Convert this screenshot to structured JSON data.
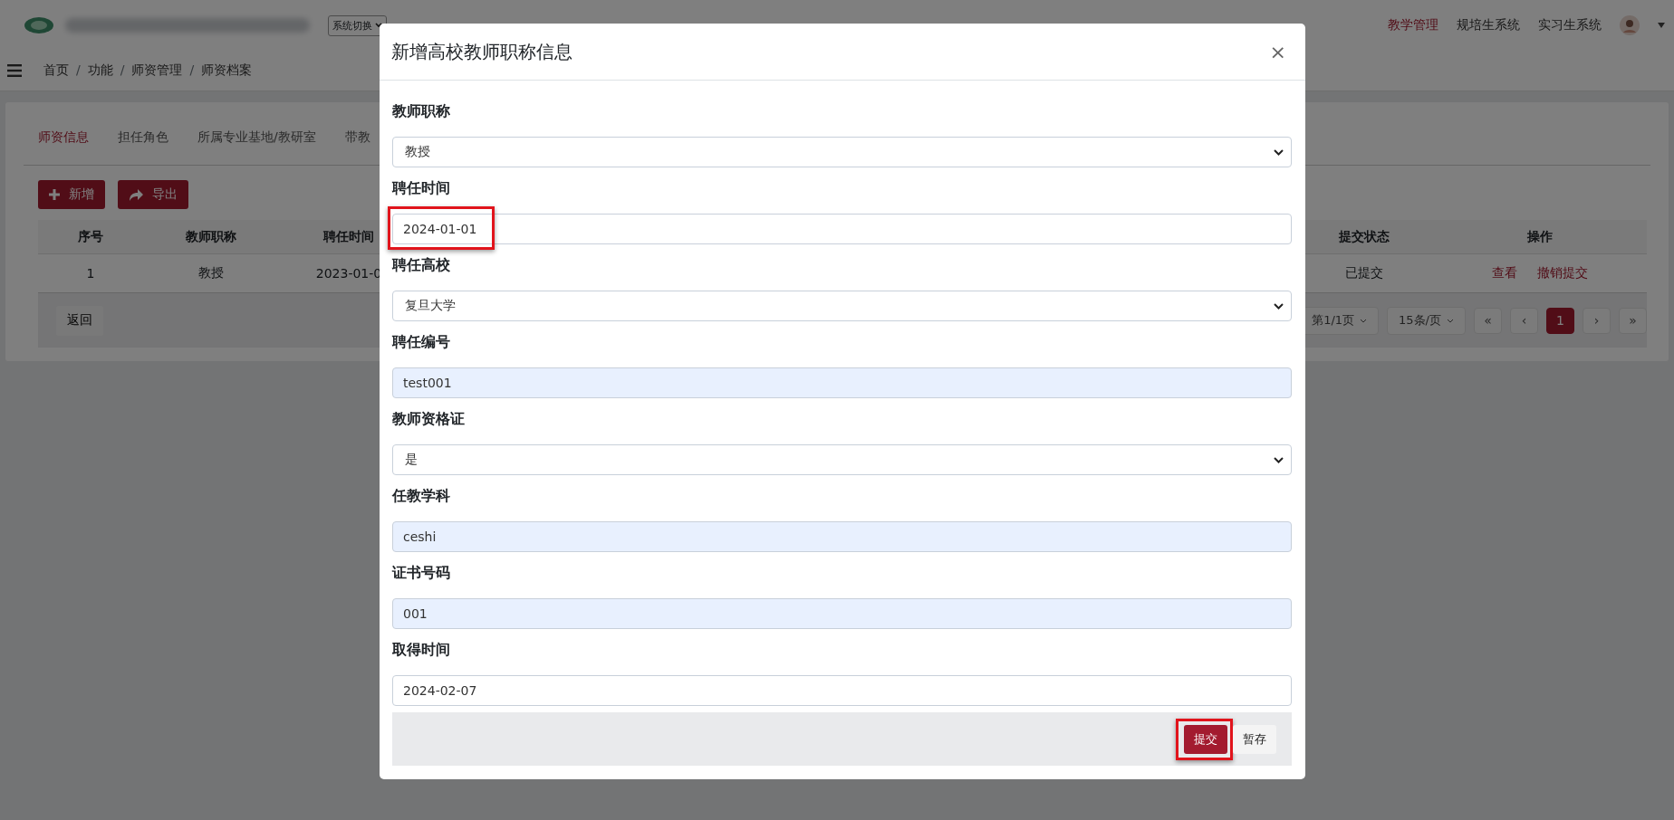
{
  "header": {
    "system_switch": "系统切换",
    "nav": [
      {
        "label": "教学管理",
        "selected": true
      },
      {
        "label": "规培生系统",
        "selected": false
      },
      {
        "label": "实习生系统",
        "selected": false
      }
    ]
  },
  "breadcrumb": [
    {
      "label": "首页",
      "kind": "link"
    },
    {
      "label": "/",
      "kind": "separator"
    },
    {
      "label": "功能",
      "kind": "link"
    },
    {
      "label": "/",
      "kind": "separator"
    },
    {
      "label": "师资管理",
      "kind": "link"
    },
    {
      "label": "/",
      "kind": "separator"
    },
    {
      "label": "师资档案",
      "kind": "link"
    }
  ],
  "tabs": [
    {
      "label": "师资信息",
      "selected": true
    },
    {
      "label": "担任角色",
      "selected": false
    },
    {
      "label": "所属专业基地/教研室",
      "selected": false
    },
    {
      "label": "带教",
      "selected": false
    }
  ],
  "toolbar": [
    {
      "label": "新增",
      "kind": "add"
    },
    {
      "label": "导出",
      "kind": "export"
    }
  ],
  "table": {
    "columns": [
      "序号",
      "教师职称",
      "聘任时间",
      "提交状态",
      "操作"
    ],
    "rows": [
      {
        "cells": [
          "1",
          "教授",
          "2023-01-0",
          "已提交"
        ],
        "actions": [
          "查看",
          "撤销提交"
        ]
      }
    ]
  },
  "footer": {
    "back": "返回",
    "page_info": "第1/1页",
    "page_size": "15条/页",
    "pages": [
      {
        "label": "«",
        "selected": false
      },
      {
        "label": "‹",
        "selected": false
      },
      {
        "label": "1",
        "selected": true
      },
      {
        "label": "›",
        "selected": false
      },
      {
        "label": "»",
        "selected": false
      }
    ]
  },
  "modal": {
    "title": "新增高校教师职称信息",
    "close": "×",
    "fields": [
      {
        "label": "教师职称",
        "kind": "select",
        "value": "教授",
        "autofilled": false,
        "highlighted": false
      },
      {
        "label": "聘任时间",
        "kind": "input",
        "value": "2024-01-01",
        "autofilled": false,
        "highlighted": true
      },
      {
        "label": "聘任高校",
        "kind": "select",
        "value": "复旦大学",
        "autofilled": false,
        "highlighted": false
      },
      {
        "label": "聘任编号",
        "kind": "input",
        "value": "test001",
        "autofilled": true,
        "highlighted": false
      },
      {
        "label": "教师资格证",
        "kind": "select",
        "value": "是",
        "autofilled": false,
        "highlighted": false
      },
      {
        "label": "任教学科",
        "kind": "input",
        "value": "ceshi",
        "autofilled": true,
        "highlighted": false
      },
      {
        "label": "证书号码",
        "kind": "input",
        "value": "001",
        "autofilled": true,
        "highlighted": false
      },
      {
        "label": "取得时间",
        "kind": "input",
        "value": "2024-02-07",
        "autofilled": false,
        "highlighted": false
      }
    ],
    "buttons": [
      {
        "label": "提交",
        "kind": "primary",
        "highlighted": true
      },
      {
        "label": "暂存",
        "kind": "secondary",
        "highlighted": false
      }
    ]
  }
}
